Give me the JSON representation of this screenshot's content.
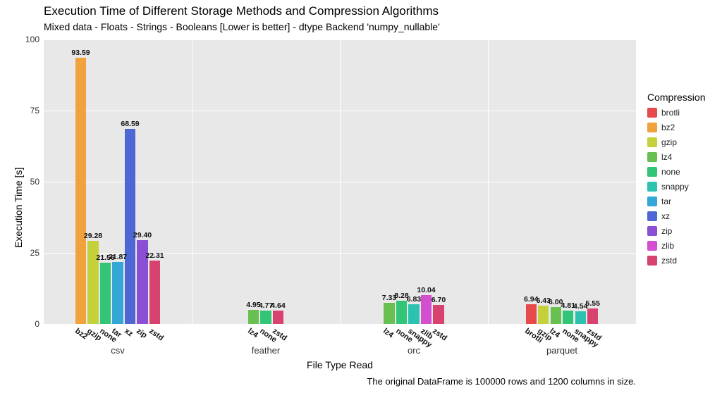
{
  "chart_data": {
    "type": "bar",
    "title": "Execution Time of Different Storage Methods and Compression Algorithms",
    "subtitle": "Mixed data - Floats - Strings - Booleans [Lower is better] - dtype Backend 'numpy_nullable'",
    "xlabel": "File Type Read",
    "ylabel": "Execution Time [s]",
    "ylim": [
      0,
      100
    ],
    "yticks": [
      0,
      25,
      50,
      75,
      100
    ],
    "legend_title": "Compression",
    "legend_order": [
      "brotli",
      "bz2",
      "gzip",
      "lz4",
      "none",
      "snappy",
      "tar",
      "xz",
      "zip",
      "zlib",
      "zstd"
    ],
    "colors": {
      "brotli": "#e74a4a",
      "bz2": "#f0a33c",
      "gzip": "#c4d13a",
      "lz4": "#67c04f",
      "none": "#32c578",
      "snappy": "#2bc3b0",
      "tar": "#35a7d6",
      "xz": "#4f67d4",
      "zip": "#8a4fd4",
      "zlib": "#d44fd0",
      "zstd": "#d8426e"
    },
    "groups": [
      {
        "name": "csv",
        "bars": [
          {
            "comp": "bz2",
            "value": 93.59
          },
          {
            "comp": "gzip",
            "value": 29.28
          },
          {
            "comp": "none",
            "value": 21.56
          },
          {
            "comp": "tar",
            "value": 21.87
          },
          {
            "comp": "xz",
            "value": 68.59
          },
          {
            "comp": "zip",
            "value": 29.4
          },
          {
            "comp": "zstd",
            "value": 22.31
          }
        ]
      },
      {
        "name": "feather",
        "bars": [
          {
            "comp": "lz4",
            "value": 4.95
          },
          {
            "comp": "none",
            "value": 4.77
          },
          {
            "comp": "zstd",
            "value": 4.64
          }
        ]
      },
      {
        "name": "orc",
        "bars": [
          {
            "comp": "lz4",
            "value": 7.33
          },
          {
            "comp": "none",
            "value": 8.28
          },
          {
            "comp": "snappy",
            "value": 6.83
          },
          {
            "comp": "zlib",
            "value": 10.04
          },
          {
            "comp": "zstd",
            "value": 6.7
          }
        ]
      },
      {
        "name": "parquet",
        "bars": [
          {
            "comp": "brotli",
            "value": 6.94
          },
          {
            "comp": "gzip",
            "value": 6.43
          },
          {
            "comp": "lz4",
            "value": 6.0
          },
          {
            "comp": "none",
            "value": 4.81
          },
          {
            "comp": "snappy",
            "value": 4.54
          },
          {
            "comp": "zstd",
            "value": 5.55
          }
        ]
      }
    ],
    "caption": "The original DataFrame is 100000 rows and 1200 columns in size."
  }
}
